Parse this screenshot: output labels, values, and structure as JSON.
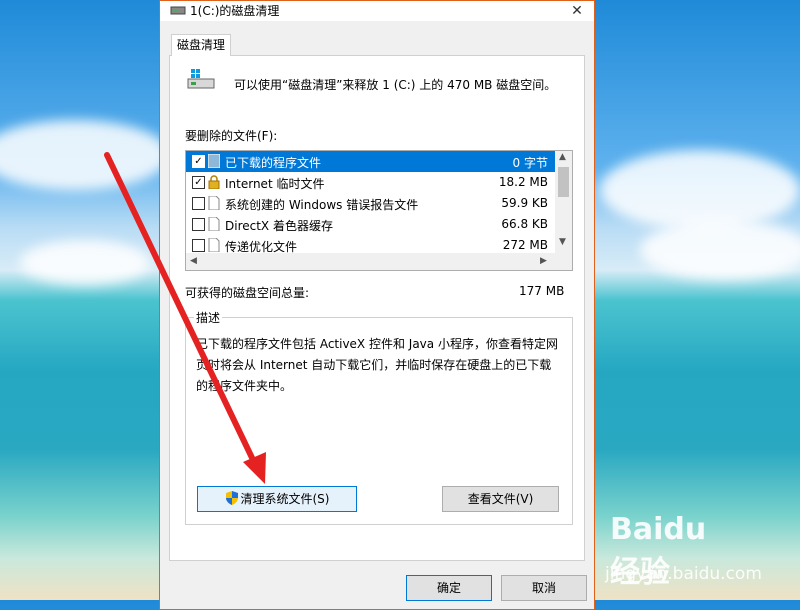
{
  "window": {
    "title": "1(C:)的磁盘清理",
    "close_label": "✕"
  },
  "tab": {
    "label": "磁盘清理"
  },
  "intro": "可以使用“磁盘清理”来释放 1 (C:) 上的 470 MB 磁盘空间。",
  "list": {
    "label": "要删除的文件(F):",
    "items": [
      {
        "checked": "✓",
        "name": "已下载的程序文件",
        "size": "0 字节",
        "icon": "folder-icon"
      },
      {
        "checked": "✓",
        "name": "Internet 临时文件",
        "size": "18.2 MB",
        "icon": "lock-icon"
      },
      {
        "checked": "",
        "name": "系统创建的 Windows 错误报告文件",
        "size": "59.9 KB",
        "icon": "file-icon"
      },
      {
        "checked": "",
        "name": "DirectX 着色器缓存",
        "size": "66.8 KB",
        "icon": "file-icon"
      },
      {
        "checked": "",
        "name": "传递优化文件",
        "size": "272 MB",
        "icon": "file-icon"
      }
    ]
  },
  "total": {
    "label": "可获得的磁盘空间总量:",
    "value": "177 MB"
  },
  "description": {
    "legend": "描述",
    "text": "已下载的程序文件包括 ActiveX 控件和 Java 小程序，你查看特定网页时将会从 Internet 自动下载它们，并临时保存在硬盘上的已下载的程序文件夹中。"
  },
  "buttons": {
    "cleanup_system": "清理系统文件(S)",
    "view_files": "查看文件(V)",
    "ok": "确定",
    "cancel": "取消"
  },
  "watermark": {
    "logo": "Baidu经验",
    "url": "jingyan.baidu.com"
  },
  "colors": {
    "accent": "#0078d7",
    "window_border": "#e0611a",
    "arrow": "#e52222"
  }
}
